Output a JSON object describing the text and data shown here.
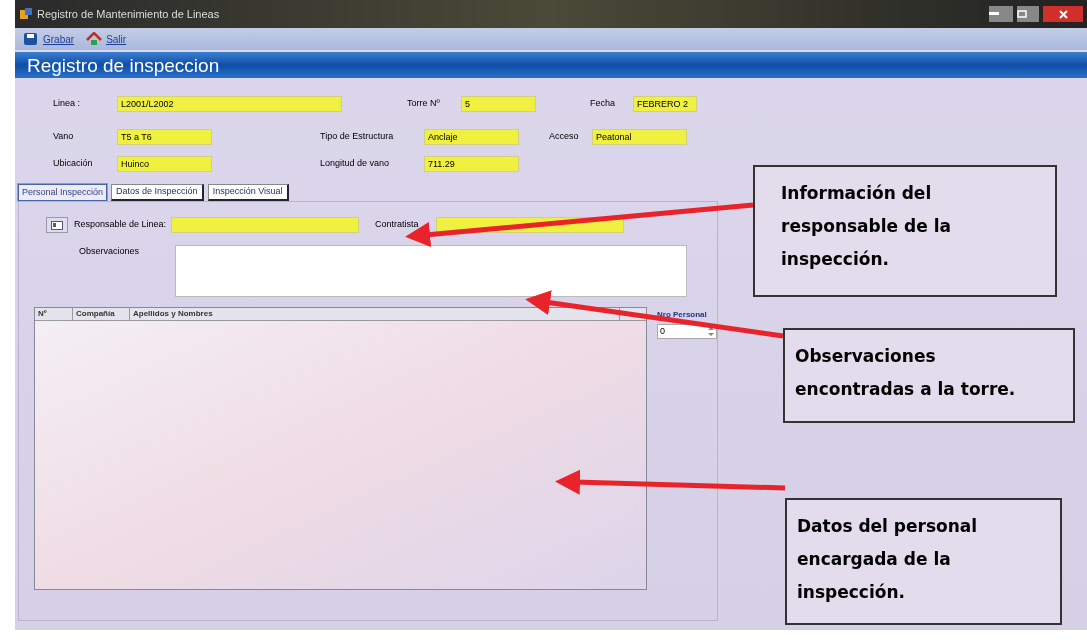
{
  "window": {
    "title": "Registro de Mantenimiento de Lineas"
  },
  "toolbar": [
    {
      "label": "Grabar",
      "kind": "save"
    },
    {
      "label": "Salir",
      "kind": "exit"
    }
  ],
  "header": {
    "title": "Registro de inspeccion"
  },
  "fields_row1": [
    {
      "label": "Linea :",
      "value": "L2001/L2002",
      "kind": "wide"
    },
    {
      "label": "Torre Nº",
      "value": "5",
      "kind": "short"
    },
    {
      "label": "Fecha",
      "value": "FEBRERO 2",
      "kind": "short"
    }
  ],
  "fields_row2": [
    {
      "label": "Vano",
      "value": "T5 a T6"
    },
    {
      "label": "Tipo de Estructura",
      "value": "Anclaje"
    },
    {
      "label": "Acceso",
      "value": "Peatonal"
    }
  ],
  "fields_row3": [
    {
      "label": "Ubicación",
      "value": "Huinco"
    },
    {
      "label": "Longitud de vano",
      "value": "711.29"
    }
  ],
  "tabs": [
    {
      "label": "Personal Inspección",
      "selected": true
    },
    {
      "label": "Datos de Inspección",
      "selected": false
    },
    {
      "label": "Inspección Visual",
      "selected": false
    }
  ],
  "personal": {
    "responsable_label": "Responsable de Linea:",
    "contratista_label": "Contratista",
    "observaciones_label": "Observaciones"
  },
  "table": {
    "columns": [
      "Nº",
      "Compañía",
      "Apellidos y Nombres"
    ]
  },
  "nro_personal": {
    "label": "Nro Personal",
    "value": "0"
  },
  "callouts": [
    {
      "text": "Información del responsable de la inspección."
    },
    {
      "text": "Observaciones encontradas a la torre."
    },
    {
      "text": "Datos del personal encargada de la inspección."
    }
  ]
}
